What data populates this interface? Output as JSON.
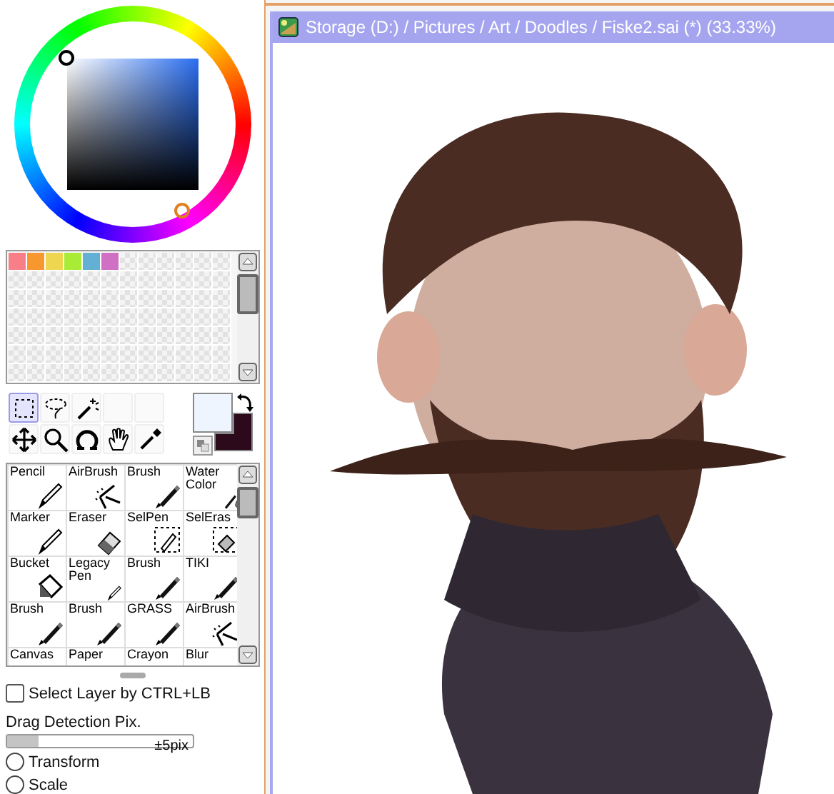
{
  "palette": {
    "swatches": [
      {
        "color": "#f87f87"
      },
      {
        "color": "#f7982f"
      },
      {
        "color": "#efd650"
      },
      {
        "color": "#a8ec36"
      },
      {
        "color": "#64b0d4"
      },
      {
        "color": "#d070c4"
      }
    ]
  },
  "current_colors": [
    {
      "kind": "primary",
      "color": "#eef5ff"
    },
    {
      "kind": "secondary",
      "color": "#2c0a1c"
    }
  ],
  "tools": [
    {
      "kind": "rect-select",
      "selected": true
    },
    {
      "kind": "lasso",
      "selected": false
    },
    {
      "kind": "wand",
      "selected": false
    },
    {
      "kind": "empty",
      "selected": false
    },
    {
      "kind": "empty",
      "selected": false
    },
    {
      "kind": "move",
      "selected": false
    },
    {
      "kind": "zoom",
      "selected": false
    },
    {
      "kind": "rotate",
      "selected": false
    },
    {
      "kind": "hand",
      "selected": false
    },
    {
      "kind": "eyedropper",
      "selected": false
    }
  ],
  "brushes": [
    {
      "label": "Pencil",
      "kind": "pencil",
      "selected": false
    },
    {
      "label": "AirBrush",
      "kind": "airbrush",
      "selected": false
    },
    {
      "label": "Brush",
      "kind": "brush",
      "selected": false
    },
    {
      "label": "Water Color",
      "kind": "water",
      "selected": false
    },
    {
      "label": "Marker",
      "kind": "pencil",
      "selected": false
    },
    {
      "label": "Eraser",
      "kind": "eraser",
      "selected": false
    },
    {
      "label": "SelPen",
      "kind": "selpen",
      "selected": false
    },
    {
      "label": "SelEras",
      "kind": "seleras",
      "selected": false
    },
    {
      "label": "Bucket",
      "kind": "bucket",
      "selected": false
    },
    {
      "label": "Legacy Pen",
      "kind": "pencil",
      "selected": false
    },
    {
      "label": "Brush",
      "kind": "brush",
      "selected": false
    },
    {
      "label": "TIKI",
      "kind": "brush",
      "selected": false
    },
    {
      "label": "Brush",
      "kind": "brush",
      "selected": false
    },
    {
      "label": "Brush",
      "kind": "brush",
      "selected": false
    },
    {
      "label": "GRASS",
      "kind": "brush",
      "selected": false
    },
    {
      "label": "AirBrush",
      "kind": "airbrush",
      "selected": false
    },
    {
      "label": "Canvas",
      "kind": "none",
      "selected": false
    },
    {
      "label": "Paper",
      "kind": "none",
      "selected": false
    },
    {
      "label": "Crayon",
      "kind": "none",
      "selected": false
    },
    {
      "label": "Blur",
      "kind": "none",
      "selected": false
    }
  ],
  "select_layer": {
    "label": "Select Layer by CTRL+LB",
    "checked": false
  },
  "drag_detection": {
    "label": "Drag Detection Pix.",
    "level": 0.17,
    "reading": "±5pix"
  },
  "modes": [
    {
      "label": "Transform",
      "selected": false
    },
    {
      "label": "Scale",
      "selected": false
    }
  ],
  "canvas_window": {
    "title": "Storage (D:) / Pictures / Art / Doodles / Fiske2.sai (*) (33.33%)"
  }
}
